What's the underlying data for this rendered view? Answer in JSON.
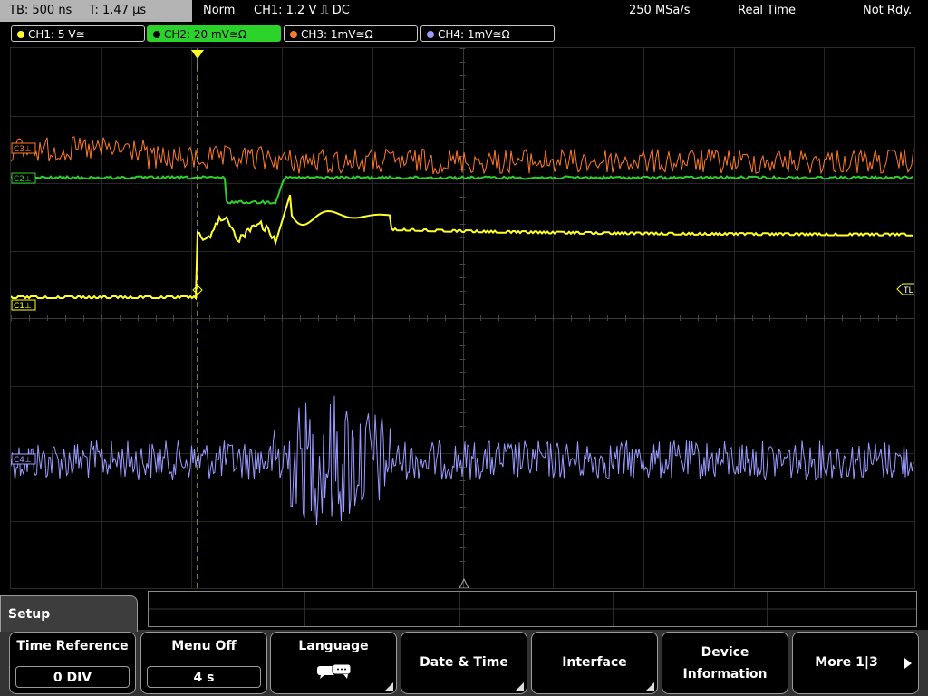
{
  "status": {
    "timebase": "TB: 500 ns",
    "trigger_time": "T: 1.47 µs",
    "trigger_mode": "Norm",
    "trigger_source": "CH1: 1.2 V ⎍ DC",
    "sample_rate": "250 MSa/s",
    "acquisition": "Real Time",
    "state": "Not Rdy."
  },
  "channels": [
    {
      "label": "CH1: 5 V≅",
      "color": "#ffff28",
      "active": false
    },
    {
      "label": "CH2: 20 mV≅Ω",
      "color": "#2ad22a",
      "active": true
    },
    {
      "label": "CH3: 1mV≅Ω",
      "color": "#ff7a28",
      "active": false
    },
    {
      "label": "CH4: 1mV≅Ω",
      "color": "#9a9aff",
      "active": false
    }
  ],
  "markers": {
    "ch1_ref": "C1⊥",
    "ch2_ref": "C2⊥",
    "ch3_ref": "C3⊥",
    "ch4_ref": "C4⊥",
    "trigger_level": "TL",
    "trigger_pos": "T"
  },
  "menu": {
    "title": "Setup",
    "softkeys": [
      {
        "label": "Time Reference",
        "value": "0 DIV"
      },
      {
        "label": "Menu Off",
        "value": "4 s"
      },
      {
        "label": "Language",
        "icon": "speech-bubbles-icon"
      },
      {
        "label": "Date & Time"
      },
      {
        "label": "Interface"
      },
      {
        "label_line1": "Device",
        "label_line2": "Information"
      },
      {
        "label": "More 1|3",
        "icon": "arrow-right-icon"
      }
    ]
  }
}
